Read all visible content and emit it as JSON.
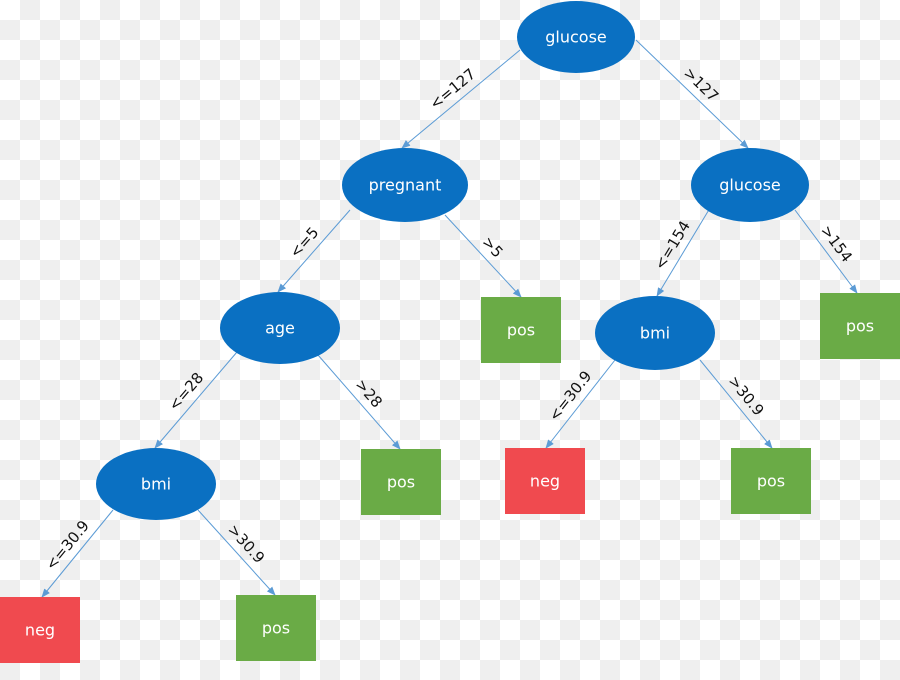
{
  "colors": {
    "decision": "#0a70c2",
    "positive": "#6aab46",
    "negative": "#f04a4f",
    "edge": "#5b9bd5"
  },
  "nodes": [
    {
      "id": "n1",
      "label": "glucose",
      "kind": "decision"
    },
    {
      "id": "n2",
      "label": "pregnant",
      "kind": "decision"
    },
    {
      "id": "n3",
      "label": "glucose",
      "kind": "decision"
    },
    {
      "id": "n4",
      "label": "age",
      "kind": "decision"
    },
    {
      "id": "n5",
      "label": "pos",
      "kind": "positive"
    },
    {
      "id": "n6",
      "label": "bmi",
      "kind": "decision"
    },
    {
      "id": "n7",
      "label": "pos",
      "kind": "positive"
    },
    {
      "id": "n8",
      "label": "bmi",
      "kind": "decision"
    },
    {
      "id": "n9",
      "label": "pos",
      "kind": "positive"
    },
    {
      "id": "n10",
      "label": "neg",
      "kind": "negative"
    },
    {
      "id": "n11",
      "label": "pos",
      "kind": "positive"
    },
    {
      "id": "n12",
      "label": "neg",
      "kind": "negative"
    },
    {
      "id": "n13",
      "label": "pos",
      "kind": "positive"
    }
  ],
  "edges": [
    {
      "from": "n1",
      "to": "n2",
      "label": "<=127"
    },
    {
      "from": "n1",
      "to": "n3",
      "label": ">127"
    },
    {
      "from": "n2",
      "to": "n4",
      "label": "<=5"
    },
    {
      "from": "n2",
      "to": "n5",
      "label": ">5"
    },
    {
      "from": "n3",
      "to": "n6",
      "label": "<=154"
    },
    {
      "from": "n3",
      "to": "n7",
      "label": ">154"
    },
    {
      "from": "n4",
      "to": "n8",
      "label": "<=28"
    },
    {
      "from": "n4",
      "to": "n9",
      "label": ">28"
    },
    {
      "from": "n6",
      "to": "n10",
      "label": "<=30.9"
    },
    {
      "from": "n6",
      "to": "n11",
      "label": ">30.9"
    },
    {
      "from": "n8",
      "to": "n12",
      "label": "<=30.9"
    },
    {
      "from": "n8",
      "to": "n13",
      "label": ">30.9"
    }
  ]
}
